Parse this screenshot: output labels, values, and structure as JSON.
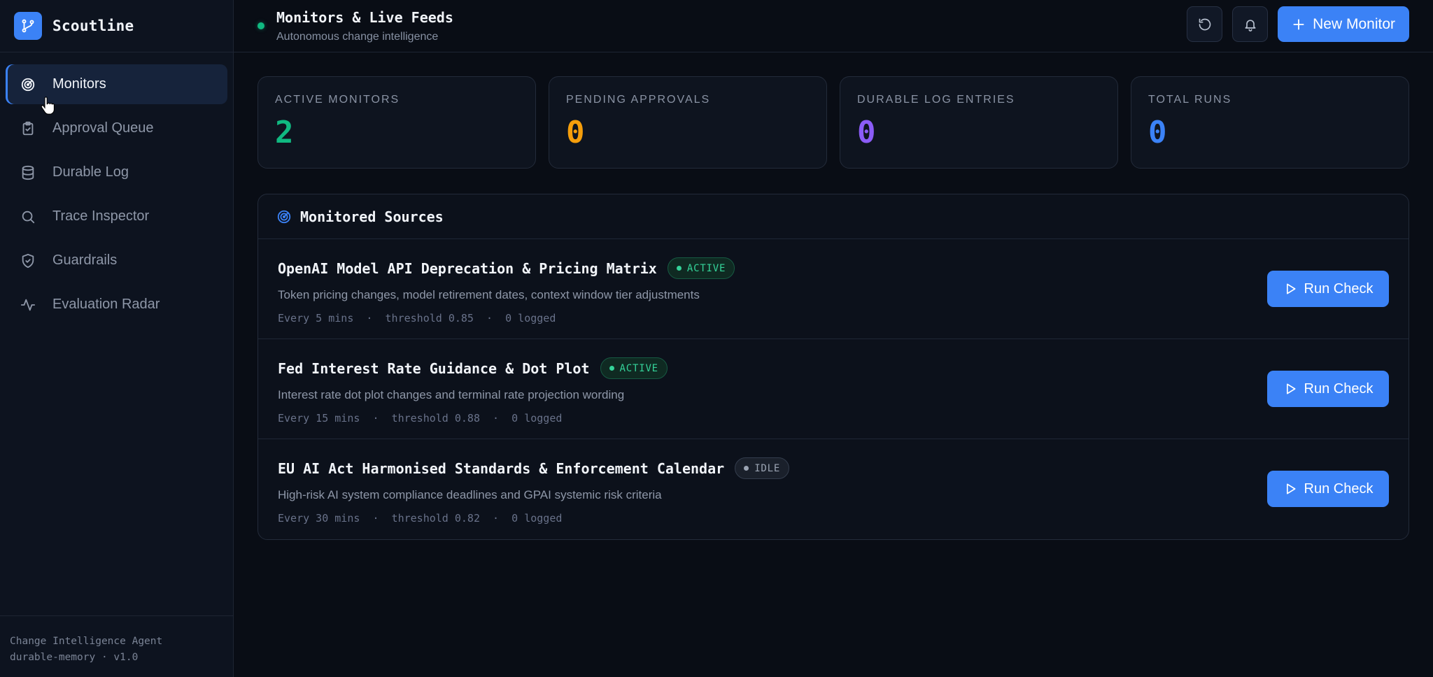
{
  "app": {
    "name": "Scoutline"
  },
  "sidebar": {
    "items": [
      {
        "label": "Monitors",
        "icon": "radar-icon",
        "active": true
      },
      {
        "label": "Approval Queue",
        "icon": "clipboard-check-icon",
        "active": false
      },
      {
        "label": "Durable Log",
        "icon": "database-icon",
        "active": false
      },
      {
        "label": "Trace Inspector",
        "icon": "search-icon",
        "active": false
      },
      {
        "label": "Guardrails",
        "icon": "shield-check-icon",
        "active": false
      },
      {
        "label": "Evaluation Radar",
        "icon": "activity-icon",
        "active": false
      }
    ],
    "footer": {
      "line1": "Change Intelligence Agent",
      "line2": "durable-memory · v1.0"
    }
  },
  "header": {
    "title": "Monitors & Live Feeds",
    "subtitle": "Autonomous change intelligence",
    "new_button": "New Monitor"
  },
  "stats": [
    {
      "label": "ACTIVE MONITORS",
      "value": "2",
      "color": "#10b981"
    },
    {
      "label": "PENDING APPROVALS",
      "value": "0",
      "color": "#f59e0b"
    },
    {
      "label": "DURABLE LOG ENTRIES",
      "value": "0",
      "color": "#8b5cf6"
    },
    {
      "label": "TOTAL RUNS",
      "value": "0",
      "color": "#3b82f6"
    }
  ],
  "panel": {
    "title": "Monitored Sources",
    "rows": [
      {
        "title": "OpenAI Model API Deprecation & Pricing Matrix",
        "status": "ACTIVE",
        "description": "Token pricing changes, model retirement dates, context window tier adjustments",
        "meta": "Every 5 mins  ·  threshold 0.85  ·  0 logged",
        "action": "Run Check"
      },
      {
        "title": "Fed Interest Rate Guidance & Dot Plot",
        "status": "ACTIVE",
        "description": "Interest rate dot plot changes and terminal rate projection wording",
        "meta": "Every 15 mins  ·  threshold 0.88  ·  0 logged",
        "action": "Run Check"
      },
      {
        "title": "EU AI Act Harmonised Standards & Enforcement Calendar",
        "status": "IDLE",
        "description": "High-risk AI system compliance deadlines and GPAI systemic risk criteria",
        "meta": "Every 30 mins  ·  threshold 0.82  ·  0 logged",
        "action": "Run Check"
      }
    ]
  },
  "colors": {
    "accent": "#3b82f6",
    "active": "#34d399",
    "idle": "#9aa3b2"
  }
}
